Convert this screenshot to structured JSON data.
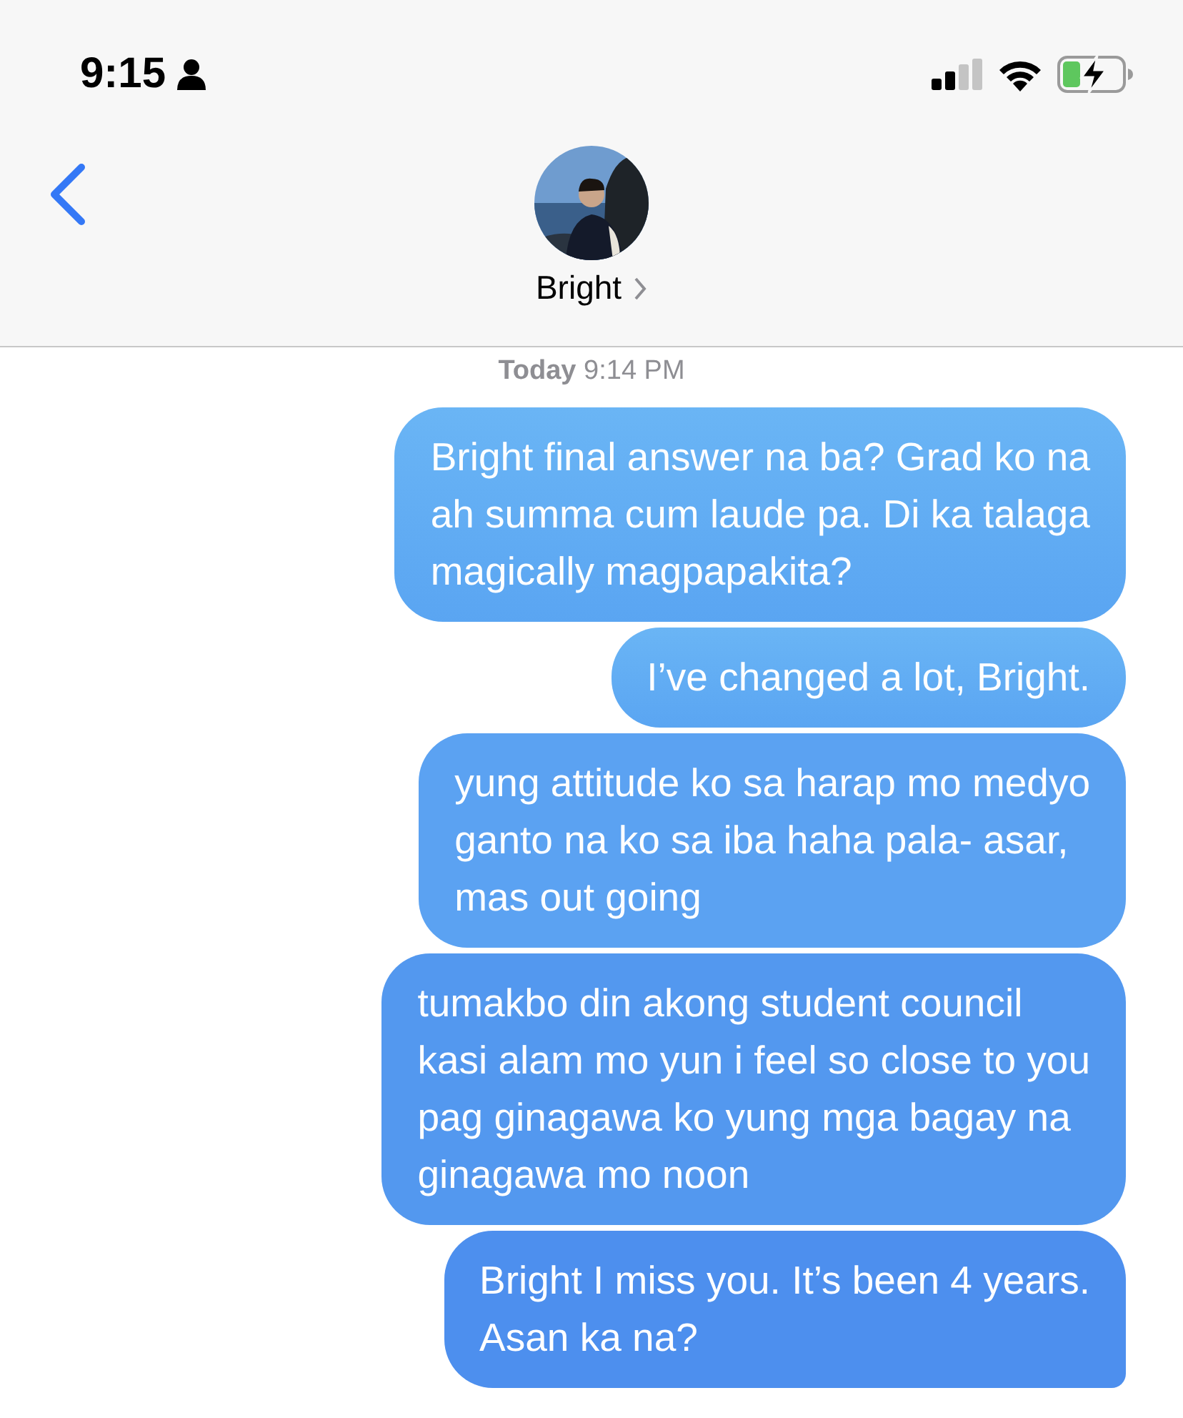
{
  "status_bar": {
    "time": "9:15"
  },
  "contact": {
    "name": "Bright"
  },
  "timestamp": {
    "day": "Today",
    "time": "9:14 PM"
  },
  "messages": [
    {
      "text": "Bright final answer na ba? Grad ko na\nah summa cum laude pa. Di ka talaga\nmagically magpapakita?",
      "tail": false
    },
    {
      "text": "I’ve changed a lot, Bright.",
      "tail": false
    },
    {
      "text": "yung attitude ko sa harap mo medyo\nganto na ko sa iba haha pala- asar,\nmas out going",
      "tail": false
    },
    {
      "text": "tumakbo din akong student council\nkasi alam mo yun i feel so close to you\npag ginagawa ko yung mga bagay na\nginagawa mo noon",
      "tail": false
    },
    {
      "text": "Bright I miss you. It’s been 4 years.\nAsan ka na?",
      "tail": true
    }
  ]
}
